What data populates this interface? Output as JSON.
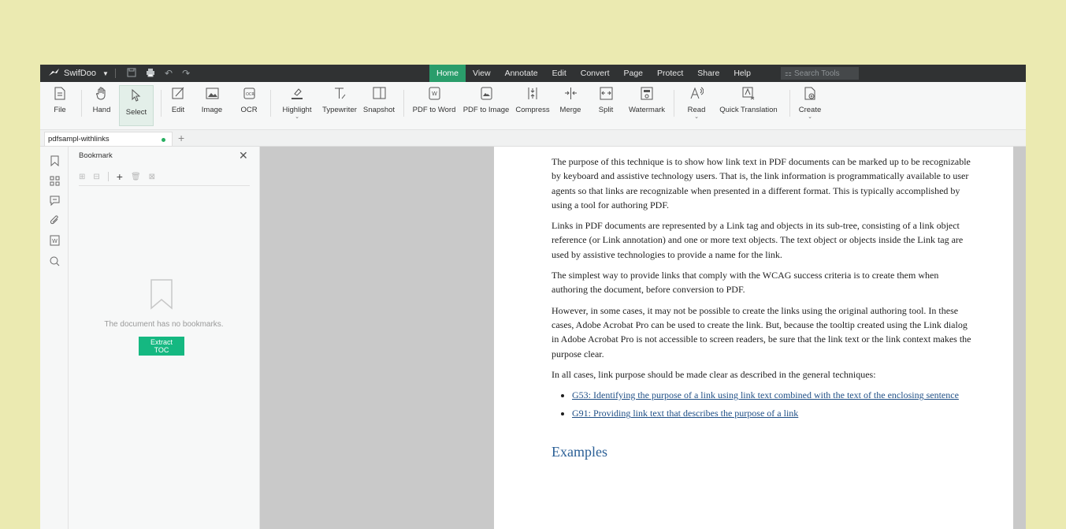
{
  "titlebar": {
    "app_name": "SwifDoo",
    "menu": [
      "Home",
      "View",
      "Annotate",
      "Edit",
      "Convert",
      "Page",
      "Protect",
      "Share",
      "Help"
    ],
    "active_menu": "Home",
    "search_placeholder": "Search Tools"
  },
  "ribbon": {
    "tools": [
      {
        "label": "File",
        "icon": "file-icon"
      },
      {
        "label": "Hand",
        "icon": "hand-icon"
      },
      {
        "label": "Select",
        "icon": "cursor-icon"
      },
      {
        "label": "Edit",
        "icon": "edit-icon"
      },
      {
        "label": "Image",
        "icon": "image-icon"
      },
      {
        "label": "OCR",
        "icon": "ocr-icon"
      },
      {
        "label": "Highlight",
        "icon": "highlight-icon"
      },
      {
        "label": "Typewriter",
        "icon": "typewriter-icon"
      },
      {
        "label": "Snapshot",
        "icon": "snapshot-icon"
      },
      {
        "label": "PDF to Word",
        "icon": "pdf-to-word-icon"
      },
      {
        "label": "PDF to Image",
        "icon": "pdf-to-image-icon"
      },
      {
        "label": "Compress",
        "icon": "compress-icon"
      },
      {
        "label": "Merge",
        "icon": "merge-icon"
      },
      {
        "label": "Split",
        "icon": "split-icon"
      },
      {
        "label": "Watermark",
        "icon": "watermark-icon"
      },
      {
        "label": "Read",
        "icon": "read-icon"
      },
      {
        "label": "Quick Translation",
        "icon": "translate-icon"
      },
      {
        "label": "Create",
        "icon": "create-icon"
      }
    ]
  },
  "tabs": {
    "doc_tab": "pdfsampl-withlinks"
  },
  "bookmark_panel": {
    "title": "Bookmark",
    "empty_text": "The document has no bookmarks.",
    "extract_button": "Extract TOC"
  },
  "document": {
    "p1": "The purpose of this technique is to show how link text in PDF documents can be marked up to be recognizable by keyboard and assistive technology users. That is, the link information is programmatically available to user agents so that links are recognizable when presented in a different format. This is typically accomplished by using a tool for authoring PDF.",
    "p2": "Links in PDF documents are represented by a Link tag and objects in its sub-tree, consisting of a link object reference (or Link annotation) and one or more text objects. The text object or objects inside the Link tag are used by assistive technologies to provide a name for the link.",
    "p3": "The simplest way to provide links that comply with the WCAG success criteria is to create them when authoring the document, before conversion to PDF.",
    "p4": "However, in some cases, it may not be possible to create the links using the original authoring tool. In these cases, Adobe Acrobat Pro can be used to create the link. But, because the tooltip created using the Link dialog in Adobe Acrobat Pro is not accessible to screen readers, be sure that the link text or the link context makes the purpose clear.",
    "p5": "In all cases, link purpose should be made clear as described in the general techniques:",
    "links": [
      "G53: Identifying the purpose of a link using link text combined with the text of the enclosing sentence",
      "G91: Providing link text that describes the purpose of a link"
    ],
    "heading": "Examples"
  },
  "colors": {
    "accent": "#2a9d6b",
    "button": "#15b881",
    "background": "#ebeab1",
    "titlebar": "#303233",
    "link": "#1f4f86"
  }
}
